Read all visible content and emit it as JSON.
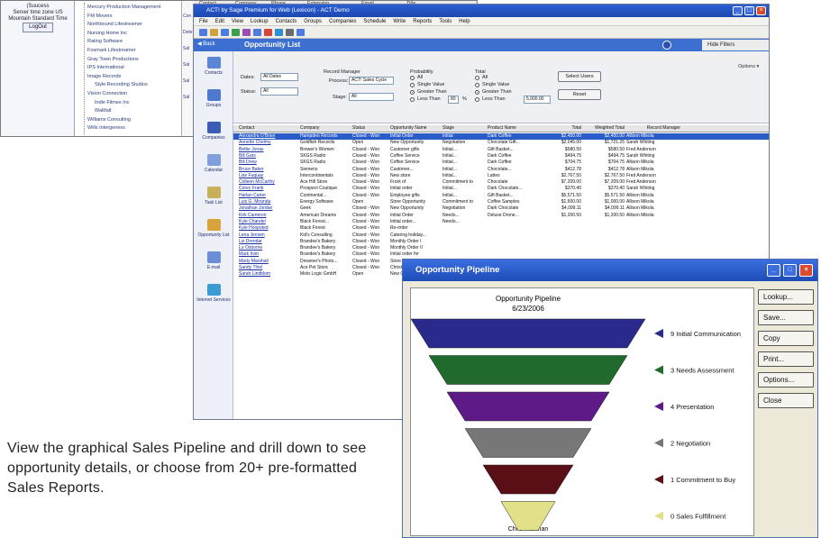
{
  "back_window": {
    "left_lines": [
      "(Suucess",
      "Server time zone US",
      "Mountain Standard Time"
    ],
    "logout_label": "LogOut",
    "tree_items": [
      "Mercury Production Management",
      "FM Movers",
      "Northbound Lifestreamer",
      "Nursing Home Inc",
      "Rating Software",
      "Foxmark Lifestreamer",
      "Gray Town Productions",
      "IPS International",
      "Image Records",
      "Style Recording Studios",
      "Vision Connection",
      "Indie Filmes Inc",
      "WaMalt",
      "Williams Consulting",
      "Wills Intergeness"
    ],
    "header_tabs": [
      "Contact",
      "Company",
      "Phone",
      "Extension",
      "Email",
      "Title"
    ],
    "right_letters": [
      "Con",
      "Dete",
      "Sal",
      "Sal",
      "Sal",
      "Sal"
    ]
  },
  "main_window": {
    "title": "ACT! by Sage Premium for Web (Lexicon) - ACT Demo",
    "menu": [
      "File",
      "Edit",
      "View",
      "Lookup",
      "Contacts",
      "Groups",
      "Companies",
      "Schedule",
      "Write",
      "Reports",
      "Tools",
      "Help"
    ],
    "back_label": "Back",
    "page_title": "Opportunity List",
    "hide_filters": "Hide Filters",
    "options_label": "Options",
    "nav": [
      {
        "label": "Contacts",
        "icon": "contacts-icon",
        "color": "#5b86d6"
      },
      {
        "label": "Groups",
        "icon": "groups-icon",
        "color": "#4d79cf"
      },
      {
        "label": "Companies",
        "icon": "companies-icon",
        "color": "#3a5cb4"
      },
      {
        "label": "Calendar",
        "icon": "calendar-icon",
        "color": "#7fa0dc"
      },
      {
        "label": "Task List",
        "icon": "task-list-icon",
        "color": "#c8b05a"
      },
      {
        "label": "Opportunity List",
        "icon": "opportunity-icon",
        "color": "#d9a23a"
      },
      {
        "label": "E-mail",
        "icon": "email-icon",
        "color": "#6a8fd8"
      },
      {
        "label": "Internet Services",
        "icon": "internet-icon",
        "color": "#3b9bd2"
      }
    ],
    "filters": {
      "dates_label": "Dates:",
      "dates_value": "All Dates",
      "status_label": "Status:",
      "status_value": "All",
      "record_manager_label": "Record Manager",
      "process_label": "Process:",
      "process_value": "ACT! Sales Cycle",
      "stage_label": "Stage:",
      "stage_value": "All",
      "probability_label": "Probability",
      "prob_options": [
        "All",
        "Single Value",
        "Greater Than",
        "Less Than"
      ],
      "greater_than_value": "80",
      "percent": "%",
      "total_label": "Total",
      "total_options": [
        "All",
        "Single Value",
        "Greater Than",
        "Less Than"
      ],
      "total_greater_value": "5,000.00",
      "select_users_label": "Select Users",
      "reset_label": "Reset"
    },
    "columns": [
      "Contact",
      "Company",
      "Status",
      "Opportunity Name",
      "Stage",
      "Product Name",
      "Total",
      "Weighted Total",
      "Record Manager"
    ],
    "rows": [
      [
        "Alexandra O'Brien",
        "Hampden Records",
        "Closed - Won",
        "Initial Order",
        "Initial",
        "Dark Coffee",
        "$2,450.00",
        "$2,450.00",
        "Allison Mikola"
      ],
      [
        "Annette Chelmy",
        "Goldfish Records",
        "Open",
        "New Opportunity",
        "Negotiation",
        "Chocolate Gift...",
        "$2,045.00",
        "$1,721.25",
        "Sarah Whiting"
      ],
      [
        "Bettie Jonas",
        "Brewer's Women",
        "Closed - Won",
        "Customer gifts",
        "Initial...",
        "Gift Basket...",
        "$580.50",
        "$580.50",
        "Fred Anderson"
      ],
      [
        "Bill Gars",
        "SKGS Radio",
        "Closed - Won",
        "Coffee Service",
        "Initial...",
        "Dark Coffee",
        "$494.75",
        "$494.75",
        "Sarah Whiting"
      ],
      [
        "Bill Drew",
        "SKGS Radio",
        "Closed - Won",
        "Coffee Service",
        "Initial...",
        "Dark Coffee",
        "$704.75",
        "$704.75",
        "Allison Mikola"
      ],
      [
        "Bruce Baker",
        "Siemens",
        "Closed - Won",
        "Customer...",
        "Initial...",
        "Chocolate...",
        "$412.78",
        "$412.78",
        "Allison Mikola"
      ],
      [
        "Lise Fuquay",
        "Intercontinentals",
        "Closed - Won",
        "New store",
        "Initial...",
        "Lattes",
        "$2,767.50",
        "$2,767.50",
        "Fred Anderson"
      ],
      [
        "Colleen McCarthy",
        "Ace Hill Store",
        "Closed - Won",
        "Front of",
        "Commitment to",
        "Chocolate",
        "$7,209.00",
        "$7,209.00",
        "Fred Anderson"
      ],
      [
        "Corey Frank",
        "Prospect Coutique",
        "Closed - Won",
        "Initial order",
        "Initial...",
        "Dark Chocolate...",
        "$370.40",
        "$370.40",
        "Sarah Whiting"
      ],
      [
        "Harlan Carter",
        "Continental...",
        "Closed - Won",
        "Employee gifts",
        "Initial...",
        "Gift Basket...",
        "$5,571.50",
        "$5,571.50",
        "Allison Mikola"
      ],
      [
        "Luis G. Miranda",
        "Energy Software",
        "Open",
        "Store Opportunity",
        "Commitment to",
        "Coffee Samples",
        "$1,600.00",
        "$1,000.00",
        "Allison Mikola"
      ],
      [
        "Jonathan Jordan",
        "Geek",
        "Closed - Won",
        "New Opportunity",
        "Negotiation",
        "Dark Chocolate",
        "$4,099.11",
        "$4,099.11",
        "Allison Mikola"
      ],
      [
        "Kirk Cameron",
        "American Dreams",
        "Closed - Won",
        "Initial Order",
        "Needs...",
        "Deluxe Drone...",
        "$1,200.50",
        "$1,200.50",
        "Allison Mikola"
      ],
      [
        "Kyle Chandel",
        "Black Forest...",
        "Closed - Won",
        "Initial order...",
        "Needs...",
        "",
        "",
        "",
        ""
      ],
      [
        "Kyle Hoopsted",
        "Black Forest",
        "Closed - Won",
        "Re-order",
        "",
        "",
        "",
        "",
        ""
      ],
      [
        "Lena Jensen",
        "Kid's Consulting",
        "Closed - Won",
        "Catering holiday...",
        "",
        "",
        "",
        "",
        ""
      ],
      [
        "Liz Drendar",
        "Brandee's Bakery",
        "Closed - Won",
        "Monthly Order I",
        "",
        "",
        "",
        "",
        ""
      ],
      [
        "Lu Osborne",
        "Brandee's Bakery",
        "Closed - Won",
        "Monthly Order II",
        "",
        "",
        "",
        "",
        ""
      ],
      [
        "Mark Irvin",
        "Brandee's Bakery",
        "Closed - Won",
        "Initial order for",
        "",
        "",
        "",
        "",
        ""
      ],
      [
        "Marty Marshall",
        "Dreamer's Photo...",
        "Closed - Won",
        "Store opening",
        "",
        "",
        "",
        "",
        ""
      ],
      [
        "Sandy Thiel",
        "Ace Pet Store",
        "Closed - Won",
        "Christmas...",
        "",
        "",
        "",
        "",
        ""
      ],
      [
        "Sarah Lindblom",
        "Moto Logic GmbH",
        "Open",
        "New Opportunity",
        "",
        "",
        "",
        "",
        ""
      ]
    ]
  },
  "pipeline_window": {
    "title": "Opportunity Pipeline",
    "chart_title": "Opportunity Pipeline",
    "chart_date": "6/23/2006",
    "footer_name": "Chris Huffman",
    "buttons": [
      "Lookup...",
      "Save...",
      "Copy",
      "Print...",
      "Options...",
      "Close"
    ]
  },
  "chart_data": {
    "type": "funnel",
    "title": "Opportunity Pipeline",
    "subtitle": "6/23/2006",
    "stages": [
      {
        "label": "9 Initial Communication",
        "count": 9,
        "color": "#2a2a8c"
      },
      {
        "label": "3 Needs Assessment",
        "count": 3,
        "color": "#1f6a2c"
      },
      {
        "label": "4 Presentation",
        "count": 4,
        "color": "#5e1a87"
      },
      {
        "label": "2 Negotiation",
        "count": 2,
        "color": "#777777"
      },
      {
        "label": "1 Commitment to Buy",
        "count": 1,
        "color": "#5a0f16"
      },
      {
        "label": "0 Sales Fulfillment",
        "count": 0,
        "color": "#e3e08a"
      }
    ]
  },
  "caption": "View the graphical Sales Pipeline and drill down to see opportunity details, or choose from 20+ pre-formatted Sales Reports."
}
